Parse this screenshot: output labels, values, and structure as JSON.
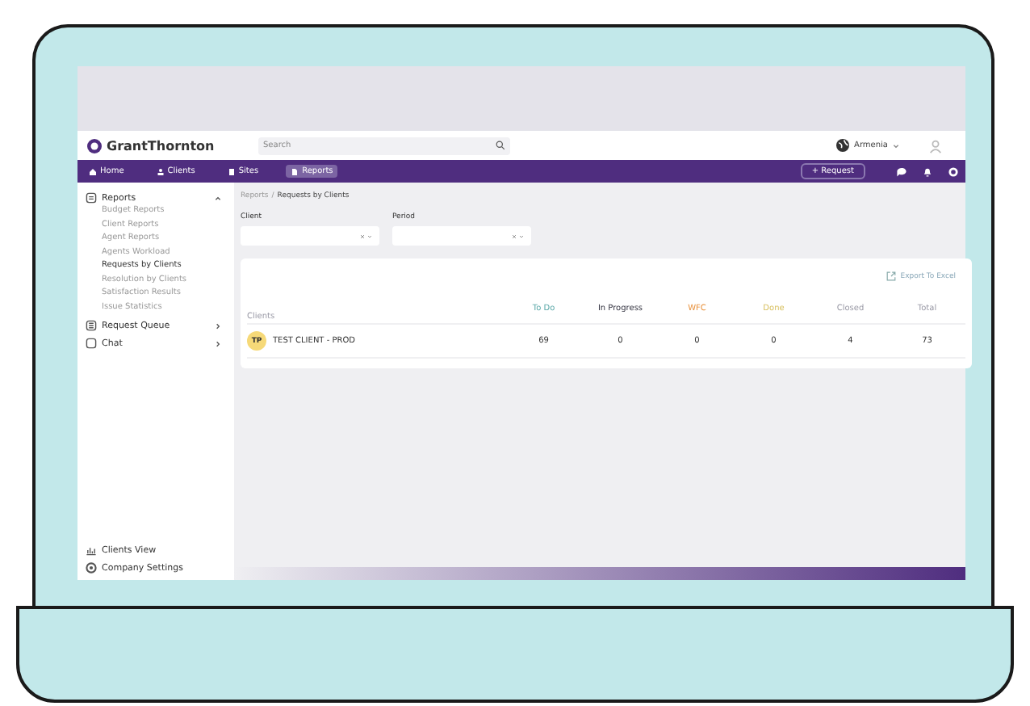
{
  "header": {
    "logo": "GrantThornton",
    "search": {
      "placeholder": "Search"
    },
    "region": "Armenia"
  },
  "nav": {
    "items": [
      {
        "label": "Home",
        "selected": false
      },
      {
        "label": "Clients",
        "selected": false
      },
      {
        "label": "Sites",
        "selected": false
      },
      {
        "label": "Reports",
        "selected": true
      }
    ],
    "request_button": "+ Request"
  },
  "sidebar": {
    "items": [
      {
        "label": "Reports",
        "expanded": true,
        "children": [
          {
            "label": "Budget Reports",
            "selected": false
          },
          {
            "label": "Client Reports",
            "selected": false
          },
          {
            "label": "Agent Reports",
            "selected": false
          },
          {
            "label": "Agents Workload",
            "selected": false
          },
          {
            "label": "Requests by Clients",
            "selected": true
          },
          {
            "label": "Resolution by Clients",
            "selected": false
          },
          {
            "label": "Satisfaction Results",
            "selected": false
          },
          {
            "label": "Issue Statistics",
            "selected": false
          }
        ]
      },
      {
        "label": "Request Queue",
        "expanded": false
      },
      {
        "label": "Chat",
        "expanded": false
      }
    ],
    "bottom": [
      {
        "label": "Clients View"
      },
      {
        "label": "Company Settings"
      }
    ]
  },
  "breadcrumb": {
    "parent": "Reports",
    "separator": "/",
    "current": "Requests by Clients"
  },
  "filters": [
    {
      "label": "Client"
    },
    {
      "label": "Period"
    }
  ],
  "export": "Export To Excel",
  "table": {
    "columns": [
      {
        "label": "Clients",
        "color": "#9a9aa6"
      },
      {
        "label": "To Do",
        "color": "#5aa8a8"
      },
      {
        "label": "In Progress",
        "color": "#333340"
      },
      {
        "label": "WFC",
        "color": "#e8903a"
      },
      {
        "label": "Done",
        "color": "#d8c060"
      },
      {
        "label": "Closed",
        "color": "#9a9aa6"
      },
      {
        "label": "Total",
        "color": "#9a9aa6"
      }
    ],
    "rows": [
      {
        "initials": "TP",
        "cells": [
          "TEST CLIENT - PROD",
          "69",
          "0",
          "0",
          "0",
          "4",
          "73"
        ]
      }
    ]
  }
}
